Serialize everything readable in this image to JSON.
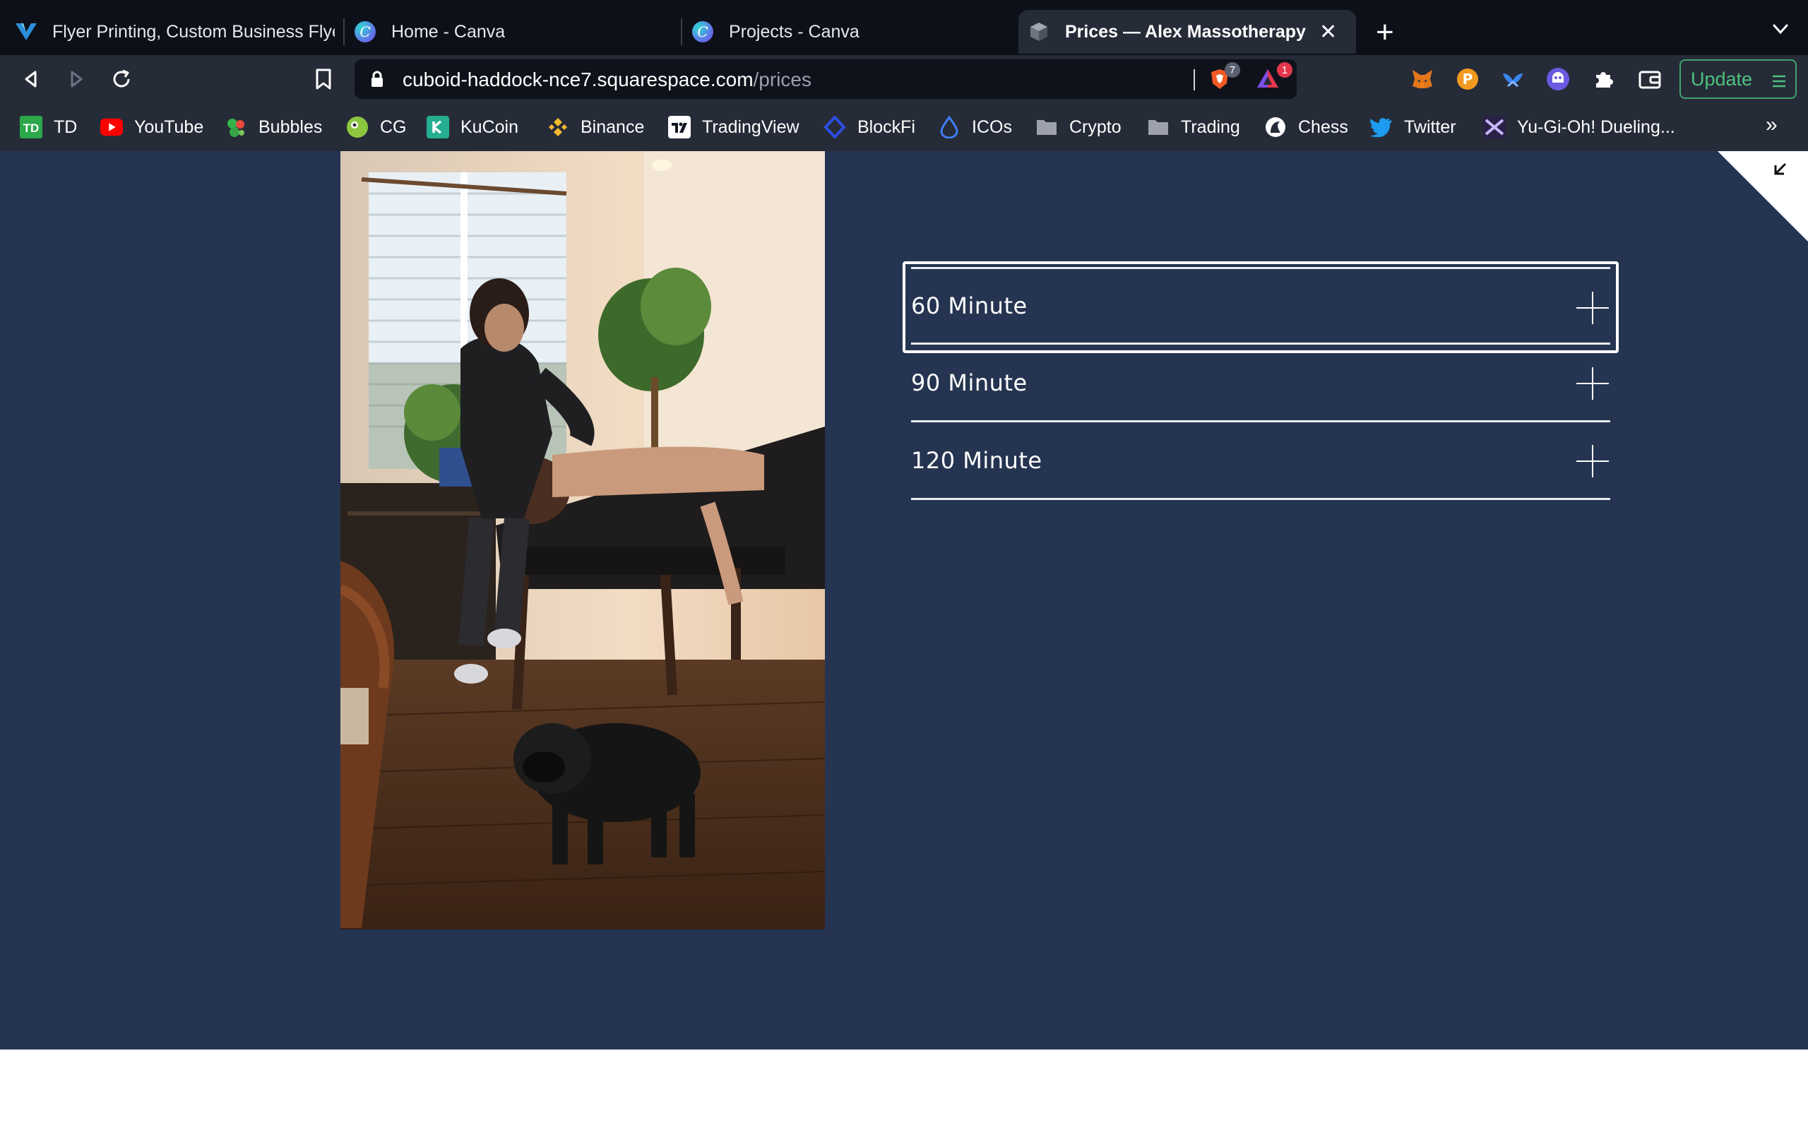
{
  "browser": {
    "tabs": [
      {
        "title": "Flyer Printing, Custom Business Flye",
        "icon": "vistaprint-icon"
      },
      {
        "title": "Home - Canva",
        "icon": "canva-icon"
      },
      {
        "title": "Projects - Canva",
        "icon": "canva-icon"
      },
      {
        "title": "Prices — Alex Massotherapy (C",
        "icon": "cube-icon",
        "active": true
      }
    ],
    "address": {
      "host": "cuboid-haddock-nce7.squarespace.com",
      "path": "/prices"
    },
    "brave_shields_count": "7",
    "brave_rewards_count": "1",
    "update_label": "Update",
    "bookmarks": [
      {
        "label": "TD",
        "icon": "td-icon"
      },
      {
        "label": "YouTube",
        "icon": "youtube-icon"
      },
      {
        "label": "Bubbles",
        "icon": "bubbles-icon"
      },
      {
        "label": "CG",
        "icon": "coingecko-icon"
      },
      {
        "label": "KuCoin",
        "icon": "kucoin-icon"
      },
      {
        "label": "Binance",
        "icon": "binance-icon"
      },
      {
        "label": "TradingView",
        "icon": "tradingview-icon"
      },
      {
        "label": "BlockFi",
        "icon": "blockfi-icon"
      },
      {
        "label": "ICOs",
        "icon": "drop-icon"
      },
      {
        "label": "Crypto",
        "icon": "folder-icon"
      },
      {
        "label": "Trading",
        "icon": "folder-icon"
      },
      {
        "label": "Chess",
        "icon": "chess-icon"
      },
      {
        "label": "Twitter",
        "icon": "twitter-icon"
      },
      {
        "label": "Yu-Gi-Oh! Dueling...",
        "icon": "yugioh-icon"
      }
    ],
    "bookmarks_overflow": "»"
  },
  "page": {
    "background": "#253450",
    "accordion": [
      {
        "label": "60 Minute"
      },
      {
        "label": "90 Minute"
      },
      {
        "label": "120 Minute"
      }
    ]
  },
  "colors": {
    "tabstrip": "#0d1018",
    "toolbar": "#262b38",
    "update_green": "#4fc27e",
    "page_navy": "#253450"
  }
}
